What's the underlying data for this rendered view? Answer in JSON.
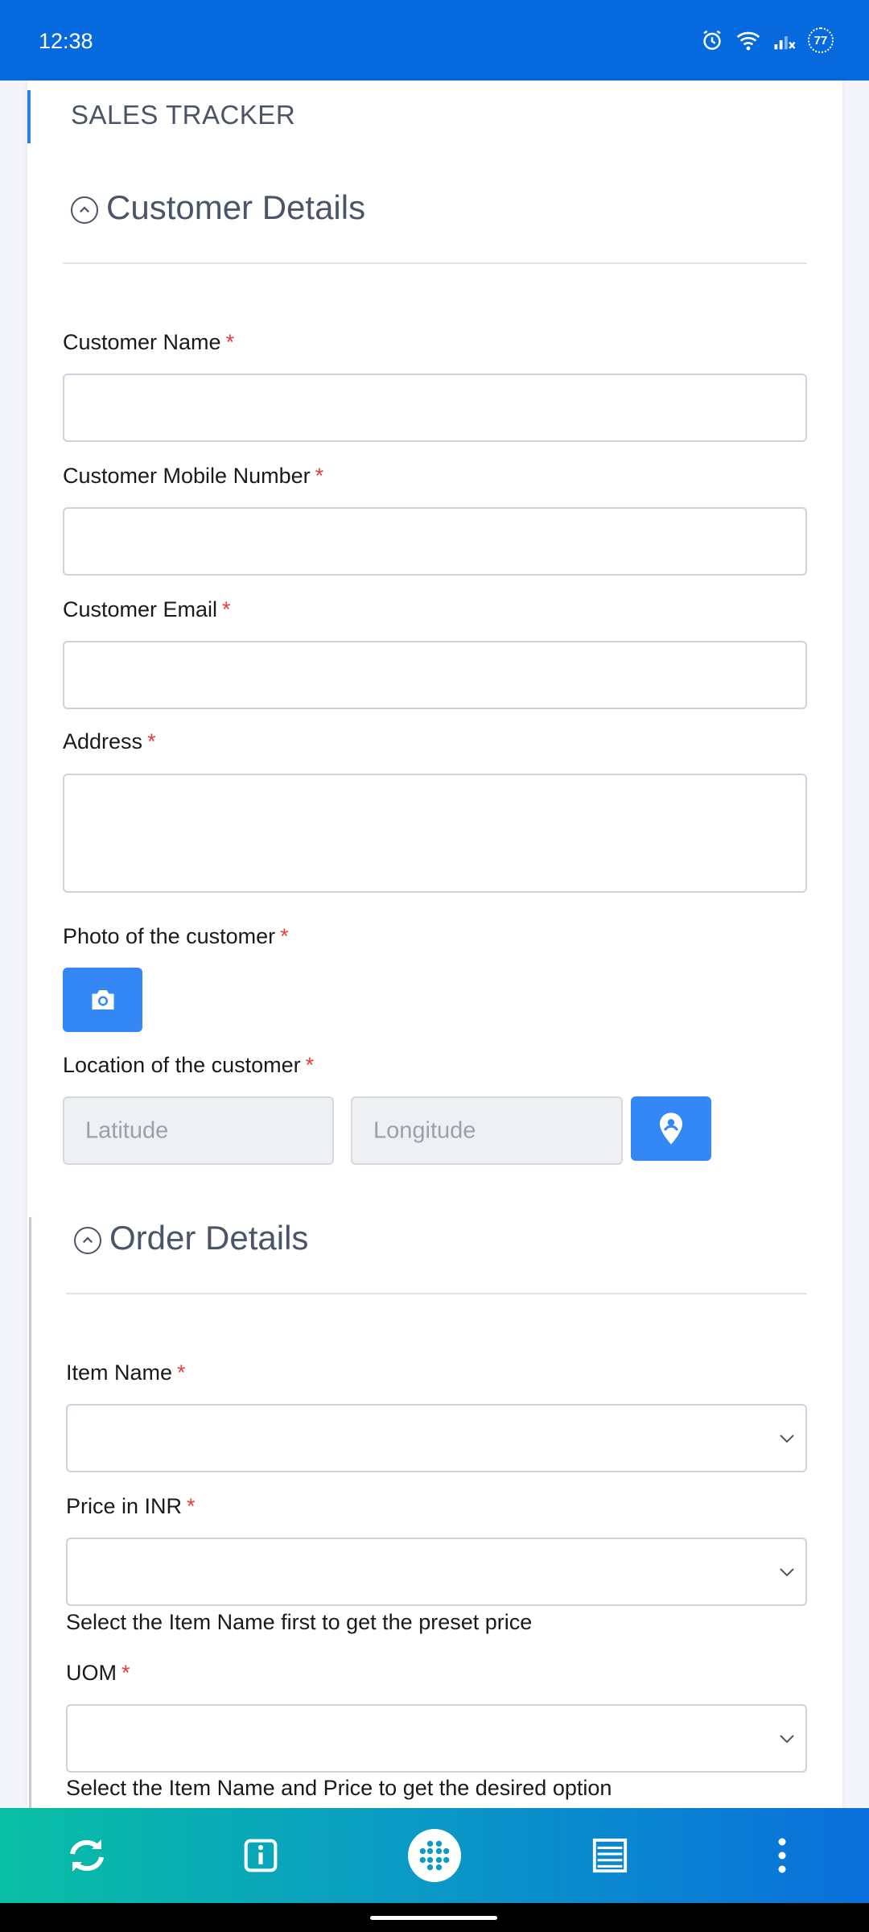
{
  "status": {
    "time": "12:38",
    "battery": "77"
  },
  "app": {
    "title": "SALES TRACKER"
  },
  "customer_section": {
    "title": "Customer Details",
    "fields": [
      {
        "label": "Customer Name",
        "value": ""
      },
      {
        "label": "Customer Mobile Number",
        "value": ""
      },
      {
        "label": "Customer Email",
        "value": ""
      },
      {
        "label": "Address",
        "value": ""
      }
    ],
    "photo_label": "Photo of the customer",
    "location_label": "Location of the customer",
    "latitude_placeholder": "Latitude",
    "longitude_placeholder": "Longitude"
  },
  "order_section": {
    "title": "Order Details",
    "item_label": "Item Name",
    "price_label": "Price in INR",
    "price_help": "Select the Item Name first to get the preset price",
    "uom_label": "UOM",
    "uom_help": "Select the Item Name and Price to get the desired option"
  },
  "required_marker": "*",
  "nav": {
    "items": [
      "sync-icon",
      "info-icon",
      "apps-grid-icon",
      "list-icon",
      "more-vertical-icon"
    ]
  }
}
